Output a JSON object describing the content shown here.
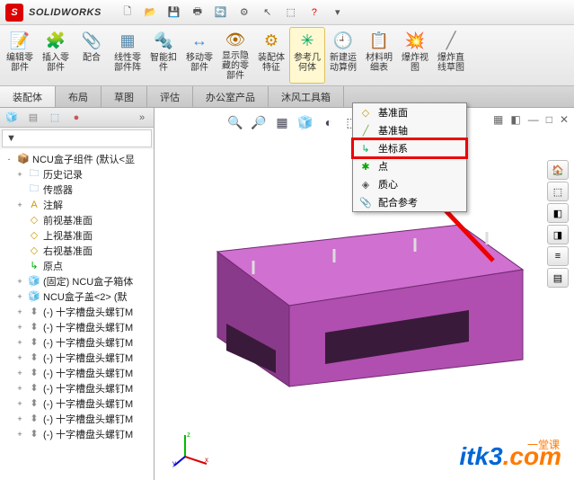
{
  "app": {
    "brand": "SOLIDWORKS",
    "qat_icons": [
      "new-icon",
      "open-icon",
      "save-icon",
      "print-icon",
      "refresh-icon",
      "options-icon",
      "pointer-icon",
      "select-icon",
      "help-icon"
    ]
  },
  "ribbon": [
    {
      "id": "edit-part",
      "label": "编辑零\n部件",
      "icon": "📝",
      "color": "#2a7"
    },
    {
      "id": "insert-part",
      "label": "插入零\n部件",
      "icon": "🧩",
      "color": "#48c"
    },
    {
      "id": "mate",
      "label": "配合",
      "icon": "📎",
      "color": "#888"
    },
    {
      "id": "linear-pattern",
      "label": "线性零\n部件阵",
      "icon": "▦",
      "color": "#58a"
    },
    {
      "id": "smart-fastener",
      "label": "智能扣\n件",
      "icon": "🔩",
      "color": "#c80"
    },
    {
      "id": "move-part",
      "label": "移动零\n部件",
      "icon": "↔",
      "color": "#48c"
    },
    {
      "id": "show-hidden",
      "label": "显示隐\n藏的零\n部件",
      "icon": "👁",
      "color": "#a60"
    },
    {
      "id": "assembly-feature",
      "label": "装配体\n特征",
      "icon": "⚙",
      "color": "#c80"
    },
    {
      "id": "ref-geom",
      "label": "参考几\n何体",
      "icon": "✳",
      "color": "#0a6",
      "hl": true
    },
    {
      "id": "new-motion",
      "label": "新建运\n动算例",
      "icon": "🕘",
      "color": "#48c"
    },
    {
      "id": "bom",
      "label": "材料明\n细表",
      "icon": "📋",
      "color": "#888"
    },
    {
      "id": "exploded",
      "label": "爆炸视\n图",
      "icon": "💥",
      "color": "#c90"
    },
    {
      "id": "explode-line",
      "label": "爆炸直\n线草图",
      "icon": "╱",
      "color": "#888"
    }
  ],
  "tabs": [
    "装配体",
    "布局",
    "草图",
    "评估",
    "办公室产品",
    "沐风工具箱"
  ],
  "active_tab": 0,
  "sidebar": {
    "filter_icon": "▼",
    "tree": [
      {
        "exp": "-",
        "icon": "📦",
        "color": "#c90",
        "label": "NCU盒子组件  (默认<显",
        "root": true
      },
      {
        "exp": "+",
        "icon": "🗀",
        "color": "#69c",
        "label": "历史记录",
        "ind": 1
      },
      {
        "exp": "",
        "icon": "🗀",
        "color": "#69c",
        "label": "传感器",
        "ind": 1
      },
      {
        "exp": "+",
        "icon": "A",
        "color": "#c90",
        "label": "注解",
        "ind": 1
      },
      {
        "exp": "",
        "icon": "◇",
        "color": "#c90",
        "label": "前视基准面",
        "ind": 1
      },
      {
        "exp": "",
        "icon": "◇",
        "color": "#c90",
        "label": "上视基准面",
        "ind": 1
      },
      {
        "exp": "",
        "icon": "◇",
        "color": "#c90",
        "label": "右视基准面",
        "ind": 1
      },
      {
        "exp": "",
        "icon": "↳",
        "color": "#0a0",
        "label": "原点",
        "ind": 1
      },
      {
        "exp": "+",
        "icon": "🧊",
        "color": "#c90",
        "label": "(固定) NCU盒子箱体",
        "ind": 1
      },
      {
        "exp": "+",
        "icon": "🧊",
        "color": "#c90",
        "label": "NCU盒子盖<2> (默",
        "ind": 1
      },
      {
        "exp": "+",
        "icon": "⬍",
        "color": "#888",
        "label": "(-) 十字槽盘头螺钉M",
        "ind": 1
      },
      {
        "exp": "+",
        "icon": "⬍",
        "color": "#888",
        "label": "(-) 十字槽盘头螺钉M",
        "ind": 1
      },
      {
        "exp": "+",
        "icon": "⬍",
        "color": "#888",
        "label": "(-) 十字槽盘头螺钉M",
        "ind": 1
      },
      {
        "exp": "+",
        "icon": "⬍",
        "color": "#888",
        "label": "(-) 十字槽盘头螺钉M",
        "ind": 1
      },
      {
        "exp": "+",
        "icon": "⬍",
        "color": "#888",
        "label": "(-) 十字槽盘头螺钉M",
        "ind": 1
      },
      {
        "exp": "+",
        "icon": "⬍",
        "color": "#888",
        "label": "(-) 十字槽盘头螺钉M",
        "ind": 1
      },
      {
        "exp": "+",
        "icon": "⬍",
        "color": "#888",
        "label": "(-) 十字槽盘头螺钉M",
        "ind": 1
      },
      {
        "exp": "+",
        "icon": "⬍",
        "color": "#888",
        "label": "(-) 十字槽盘头螺钉M",
        "ind": 1
      },
      {
        "exp": "+",
        "icon": "⬍",
        "color": "#888",
        "label": "(-) 十字槽盘头螺钉M",
        "ind": 1
      }
    ]
  },
  "dropdown": {
    "items": [
      {
        "icon": "◇",
        "color": "#c90",
        "label": "基准面"
      },
      {
        "icon": "╱",
        "color": "#7a4",
        "label": "基准轴"
      },
      {
        "icon": "↳",
        "color": "#0a6",
        "label": "坐标系",
        "hl": true
      },
      {
        "icon": "✱",
        "color": "#0a0",
        "label": "点"
      },
      {
        "icon": "◈",
        "color": "#555",
        "label": "质心"
      },
      {
        "icon": "📎",
        "color": "#888",
        "label": "配合参考"
      }
    ]
  },
  "view_tools": [
    "🔍",
    "🔎",
    "▦",
    "🧊",
    "◐",
    "⬚",
    "↻",
    "⬚",
    "🖼",
    "📋"
  ],
  "right_tools": [
    "🏠",
    "⬚",
    "◧",
    "◨",
    "≡",
    "▤"
  ],
  "triad_labels": {
    "x": "x",
    "y": "y",
    "z": "z"
  },
  "watermark": {
    "text_blue": "itk3",
    "text_orange": ".com",
    "sub": "一堂课"
  }
}
